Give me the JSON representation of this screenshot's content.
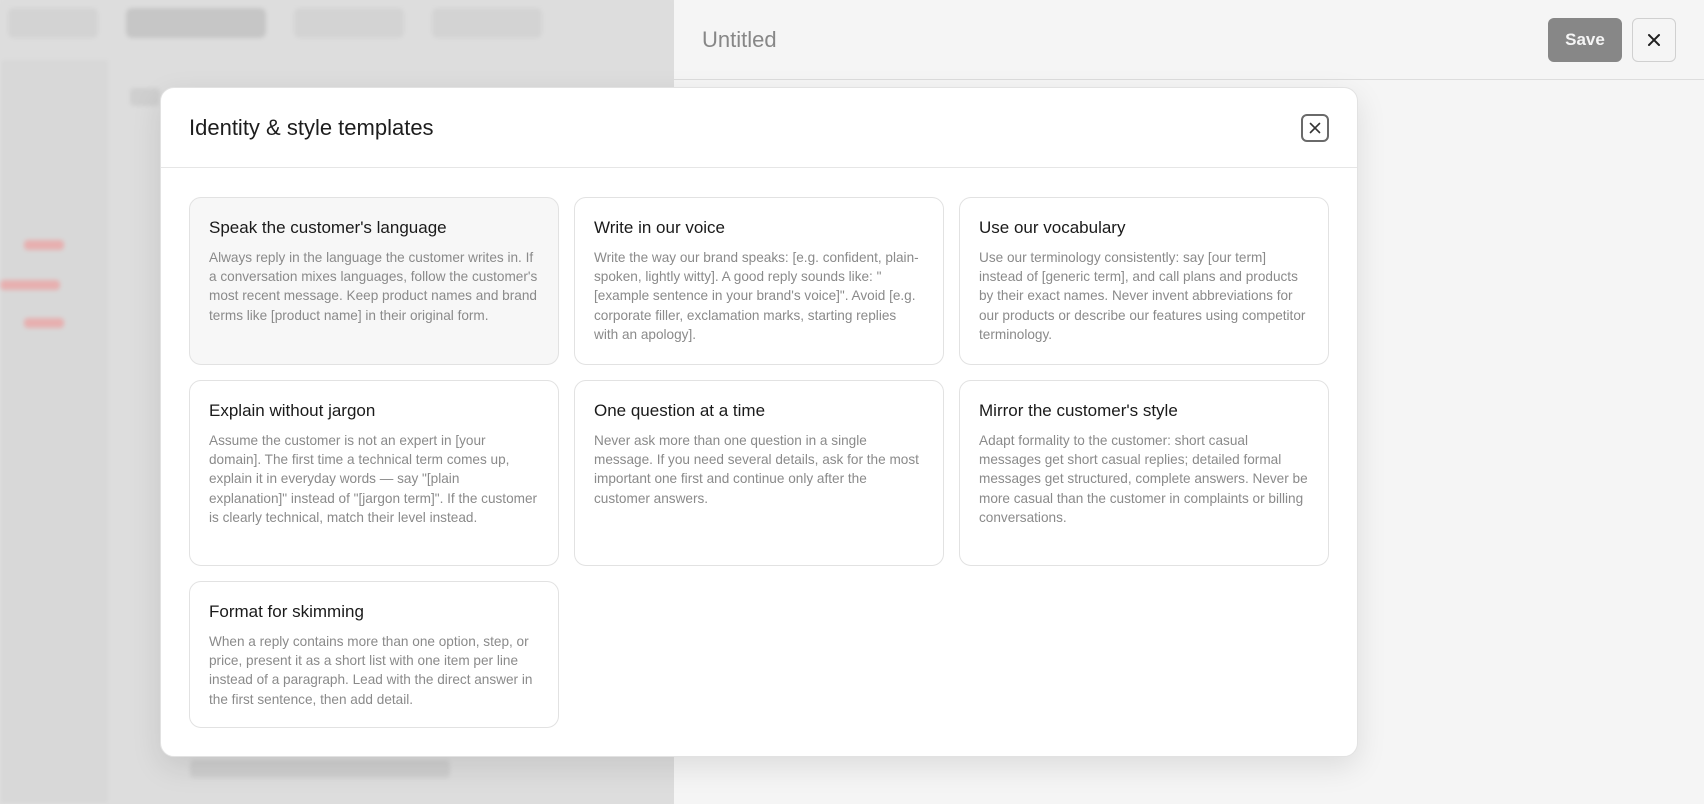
{
  "panel": {
    "title": "Untitled",
    "save_label": "Save"
  },
  "modal": {
    "title": "Identity & style templates",
    "templates": [
      {
        "title": "Speak the customer's language",
        "body": "Always reply in the language the customer writes in. If a conversation mixes languages, follow the customer's most recent message. Keep product names and brand terms like [product name] in their original form."
      },
      {
        "title": "Write in our voice",
        "body": "Write the way our brand speaks: [e.g. confident, plain-spoken, lightly witty]. A good reply sounds like: \"[example sentence in your brand's voice]\". Avoid [e.g. corporate filler, exclamation marks, starting replies with an apology]."
      },
      {
        "title": "Use our vocabulary",
        "body": "Use our terminology consistently: say [our term] instead of [generic term], and call plans and products by their exact names. Never invent abbreviations for our products or describe our features using competitor terminology."
      },
      {
        "title": "Explain without jargon",
        "body": "Assume the customer is not an expert in [your domain]. The first time a technical term comes up, explain it in everyday words — say \"[plain explanation]\" instead of \"[jargon term]\". If the customer is clearly technical, match their level instead."
      },
      {
        "title": "One question at a time",
        "body": "Never ask more than one question in a single message. If you need several details, ask for the most important one first and continue only after the customer answers."
      },
      {
        "title": "Mirror the customer's style",
        "body": "Adapt formality to the customer: short casual messages get short casual replies; detailed formal messages get structured, complete answers. Never be more casual than the customer in complaints or billing conversations."
      },
      {
        "title": "Format for skimming",
        "body": "When a reply contains more than one option, step, or price, present it as a short list with one item per line instead of a paragraph. Lead with the direct answer in the first sentence, then add detail."
      }
    ]
  }
}
